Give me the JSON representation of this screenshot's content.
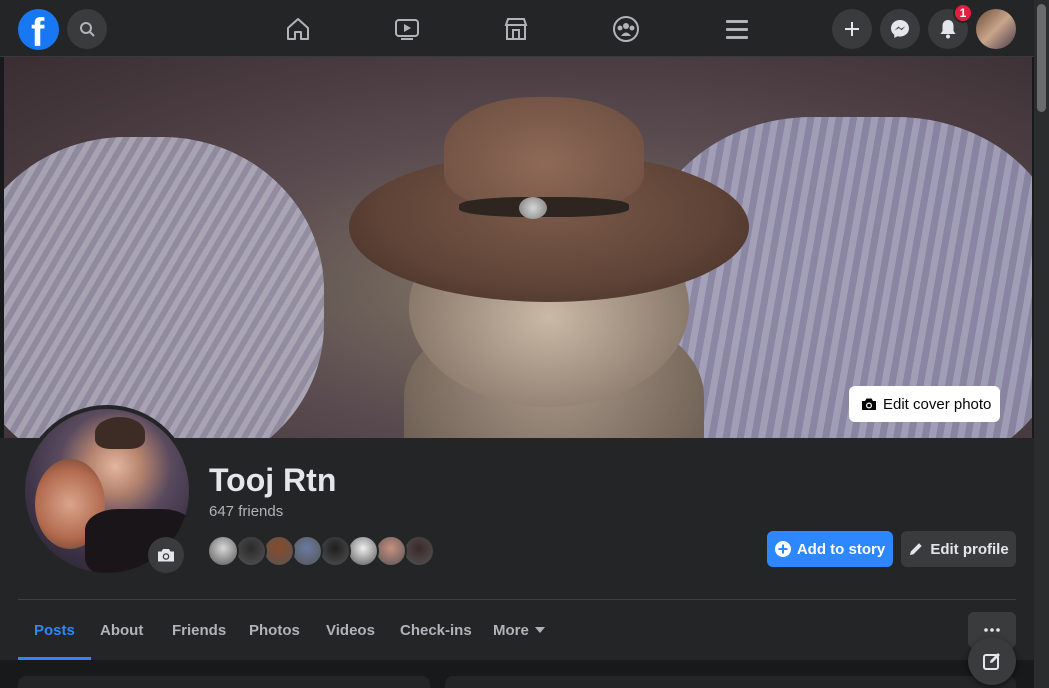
{
  "nav": {
    "logo_letter": "f",
    "notifications_badge": "1",
    "icons": [
      "facebook-logo",
      "search-icon",
      "home-icon",
      "watch-icon",
      "marketplace-icon",
      "groups-icon",
      "menu-icon",
      "plus-icon",
      "messenger-icon",
      "bell-icon"
    ]
  },
  "cover": {
    "edit_label": "Edit cover photo"
  },
  "profile": {
    "name": "Tooj Rtn",
    "friends_count": "647 friends",
    "friend_avatar_colors": [
      "#d8d8d8",
      "#2a2a2a",
      "#8a4a2a",
      "#6a7aa0",
      "#1e1e1e",
      "#f0f0f0",
      "#c89080",
      "#3a2a2a"
    ]
  },
  "actions": {
    "add_story": "Add to story",
    "edit_profile": "Edit profile"
  },
  "tabs": [
    {
      "label": "Posts",
      "active": true
    },
    {
      "label": "About",
      "active": false
    },
    {
      "label": "Friends",
      "active": false
    },
    {
      "label": "Photos",
      "active": false
    },
    {
      "label": "Videos",
      "active": false
    },
    {
      "label": "Check-ins",
      "active": false
    },
    {
      "label": "More",
      "active": false
    }
  ],
  "colors": {
    "accent": "#2d88ff",
    "background": "#18191a",
    "surface": "#242526",
    "badge": "#e41e3f"
  }
}
